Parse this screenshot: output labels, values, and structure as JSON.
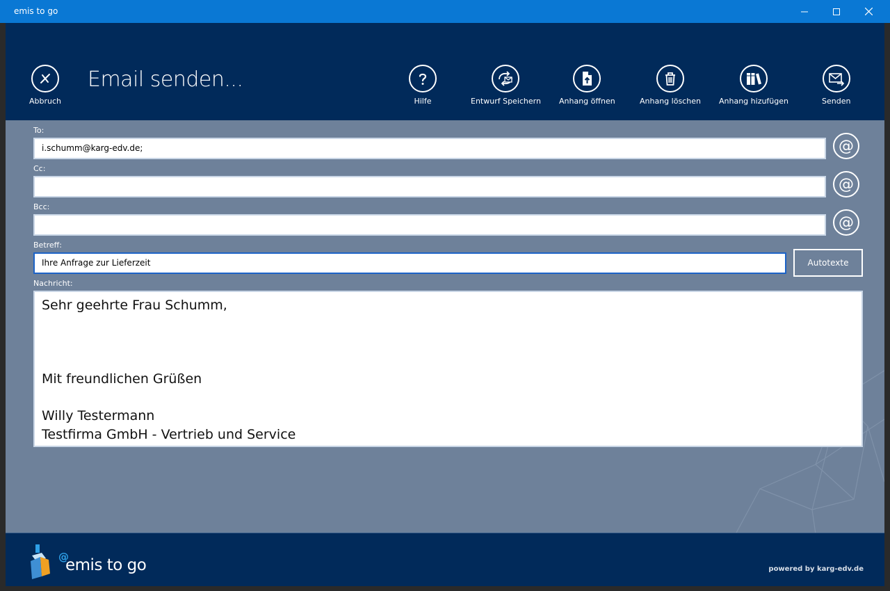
{
  "window": {
    "title": "emis to go"
  },
  "toolbar": {
    "cancel_label": "Abbruch",
    "page_title": "Email senden...",
    "help_label": "Hilfe",
    "save_draft_label": "Entwurf Speichern",
    "open_attachment_label": "Anhang öffnen",
    "delete_attachment_label": "Anhang löschen",
    "add_attachment_label": "Anhang hizufügen",
    "send_label": "Senden"
  },
  "form": {
    "to_label": "To:",
    "to_value": "i.schumm@karg-edv.de;",
    "cc_label": "Cc:",
    "cc_value": "",
    "bcc_label": "Bcc:",
    "bcc_value": "",
    "subject_label": "Betreff:",
    "subject_value": "Ihre Anfrage zur Lieferzeit",
    "autotext_label": "Autotexte",
    "message_label": "Nachricht:",
    "at_symbol": "@",
    "message_lines": [
      "Sehr geehrte Frau Schumm,",
      "",
      "",
      "",
      "Mit freundlichen Grüßen",
      "",
      "Willy Testermann",
      "Testfirma GmbH - Vertrieb und Service"
    ]
  },
  "footer": {
    "logo_at": "@",
    "logo_text": "emis to go",
    "powered_by": "powered by karg-edv.de"
  },
  "colors": {
    "titlebar": "#0a78d4",
    "header": "#012a5a",
    "form_bg": "#6e819a",
    "focus_border": "#1c63c7"
  }
}
